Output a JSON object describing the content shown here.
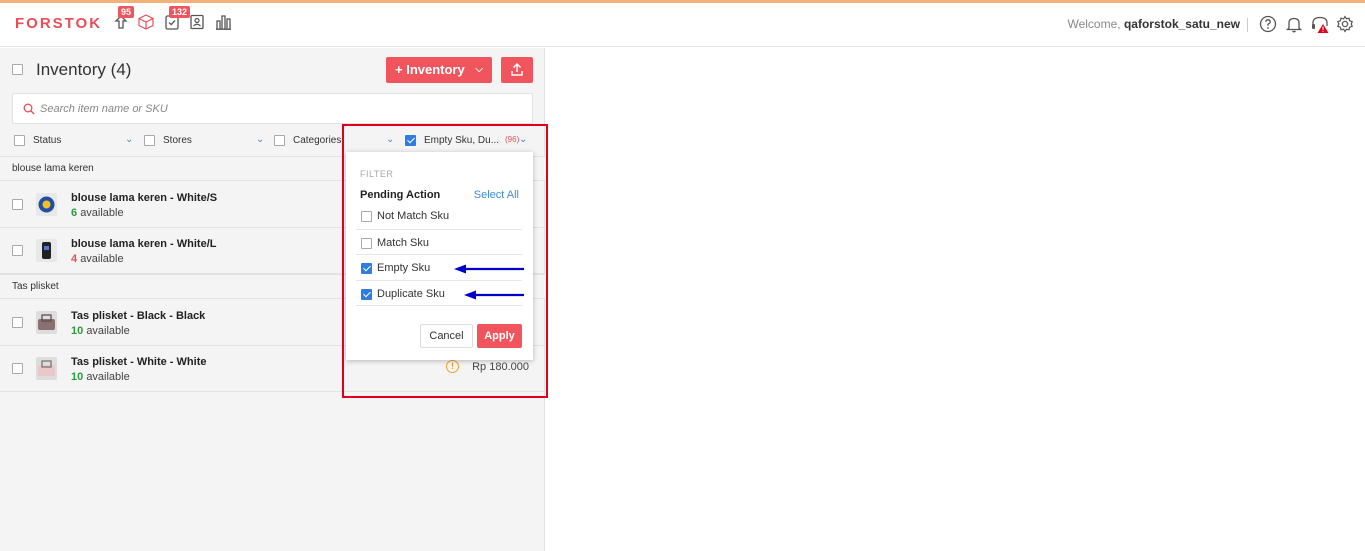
{
  "header": {
    "logo": "FORSTOK",
    "badge_orders": "95",
    "badge_tasks": "132",
    "welcome_prefix": "Welcome,",
    "username": "qaforstok_satu_new"
  },
  "inventory": {
    "title": "Inventory",
    "count": "(4)",
    "add_button": "+ Inventory",
    "search_placeholder": "Search item name or SKU"
  },
  "filters": {
    "status": "Status",
    "stores": "Stores",
    "categories": "Categories",
    "sku": "Empty Sku, Du...",
    "sku_count": "(96)"
  },
  "groups": [
    {
      "name": "blouse lama keren",
      "items": [
        {
          "name": "blouse lama keren - White/S",
          "qty": "6",
          "avail": "available",
          "qty_color": "#2e9a3e"
        },
        {
          "name": "blouse lama keren - White/L",
          "qty": "4",
          "avail": "available",
          "qty_color": "#e84e57"
        }
      ]
    },
    {
      "name": "Tas plisket",
      "items": [
        {
          "name": "Tas plisket - Black - Black",
          "qty": "10",
          "avail": "available",
          "qty_color": "#2e9a3e"
        },
        {
          "name": "Tas plisket - White - White",
          "qty": "10",
          "avail": "available",
          "qty_color": "#2e9a3e",
          "price": "Rp 180.000"
        }
      ]
    }
  ],
  "dropdown": {
    "filter_label": "FILTER",
    "heading": "Pending Action",
    "select_all": "Select All",
    "options": [
      {
        "label": "Not Match Sku",
        "checked": false
      },
      {
        "label": "Match Sku",
        "checked": false
      },
      {
        "label": "Empty Sku",
        "checked": true
      },
      {
        "label": "Duplicate Sku",
        "checked": true
      }
    ],
    "cancel": "Cancel",
    "apply": "Apply"
  },
  "colors": {
    "brand": "#e84e57",
    "accent_button": "#f0555d",
    "link": "#3d8bd4",
    "highlight_box": "#e0001b",
    "arrow": "#0000cc"
  }
}
